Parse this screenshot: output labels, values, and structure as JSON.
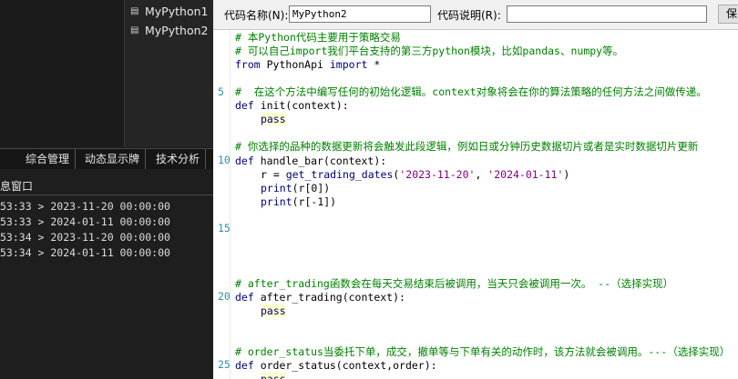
{
  "tree": {
    "items": [
      {
        "label": "MyPython1"
      },
      {
        "label": "MyPython2"
      }
    ]
  },
  "bottom_tabs": [
    "综合管理",
    "动态显示牌",
    "技术分析"
  ],
  "message_panel": {
    "title": "息窗口",
    "lines": [
      "53:33 > 2023-11-20 00:00:00",
      "53:33 > 2024-01-11 00:00:00",
      "53:34 > 2023-11-20 00:00:00",
      "53:34 > 2024-01-11 00:00:00"
    ]
  },
  "header": {
    "name_label": "代码名称(N):",
    "name_value": "MyPython2",
    "desc_label": "代码说明(R):",
    "desc_value": "",
    "save_label": "保"
  },
  "editor": {
    "line_numbers": [
      "5",
      "10",
      "15",
      "20",
      "25"
    ],
    "lines": {
      "c1": "# 本Python代码主要用于策略交易",
      "c2": "# 可以自己import我们平台支持的第三方python模块，比如pandas、numpy等。",
      "imp_kw1": "from",
      "imp_mod": " PythonApi ",
      "imp_kw2": "import",
      "imp_star": " *",
      "c3": "#  在这个方法中编写任何的初始化逻辑。context对象将会在你的算法策略的任何方法之间做传递。",
      "def_init": "def",
      "init_sig": " init(context):",
      "pass1": "pass",
      "c4": "# 你选择的品种的数据更新将会触发此段逻辑，例如日或分钟历史数据切片或者是实时数据切片更新",
      "def_hb": "def",
      "hb_sig": " handle_bar(context):",
      "r_assign": "r = ",
      "r_call": "get_trading_dates",
      "r_open": "(",
      "r_s1": "'2023-11-20'",
      "r_comma": ", ",
      "r_s2": "'2024-01-11'",
      "r_close": ")",
      "p1_kw": "print",
      "p1_rest": "(r[0])",
      "p2_kw": "print",
      "p2_rest": "(r[-1])",
      "c5": "# after_trading函数会在每天交易结束后被调用，当天只会被调用一次。 --（选择实现）",
      "def_at": "def",
      "at_sig": " after_trading(context):",
      "pass2": "pass",
      "c6": "# order_status当委托下单，成交，撤单等与下单有关的动作时，该方法就会被调用。---（选择实现）",
      "def_os": "def",
      "os_sig": " order_status(context,order):",
      "pass3": "pass"
    }
  }
}
